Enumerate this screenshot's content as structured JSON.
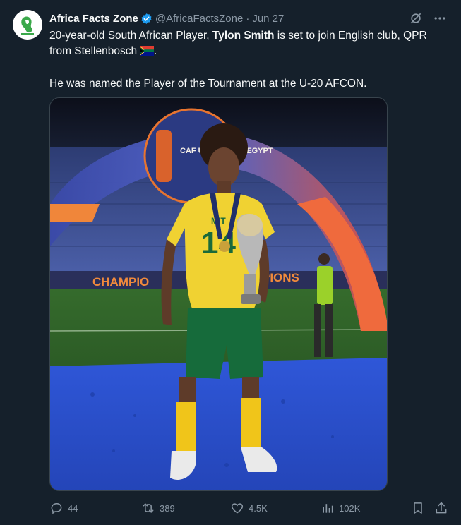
{
  "post": {
    "author_name": "Africa Facts Zone",
    "author_handle": "@AfricaFactsZone",
    "separator": "·",
    "date": "Jun 27",
    "text_line1_pre": "20-year-old South African Player, ",
    "text_player_name": "Tylon Smith",
    "text_line1_post": " is set to join English club, QPR from Stellenbosch",
    "text_para2": "He was named the Player of the Tournament at the U-20 AFCON.",
    "image_sign_top": "CAF U-20 AFCON EGYPT",
    "image_board_left": "CHAMPIO",
    "image_board_right": "PIONS",
    "image_shirt_number": "14",
    "image_shirt_text": "MIT"
  },
  "actions": {
    "replies": "44",
    "reposts": "389",
    "likes": "4.5K",
    "views": "102K"
  },
  "colors": {
    "background": "#15202b",
    "secondary_text": "#8b98a5",
    "verified": "#1d9bf0"
  }
}
